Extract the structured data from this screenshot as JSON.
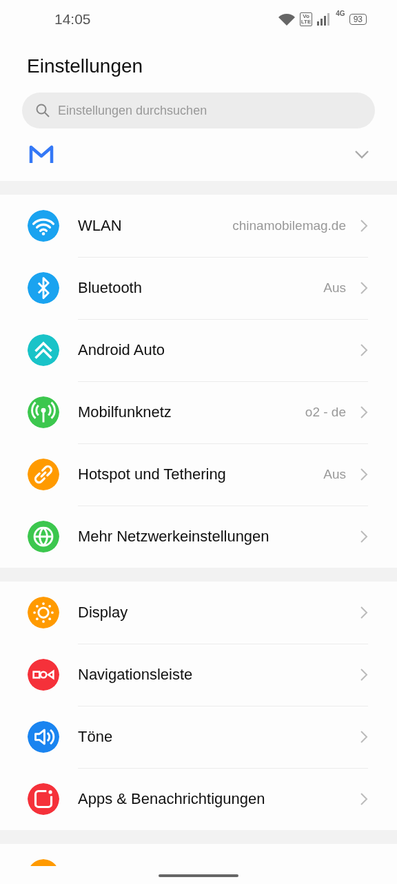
{
  "status_bar": {
    "time": "14:05",
    "volte_top": "Vo",
    "volte_bottom": "LTE",
    "network": "4G",
    "battery": "93"
  },
  "title": "Einstellungen",
  "search": {
    "placeholder": "Einstellungen durchsuchen"
  },
  "groups": [
    {
      "items": [
        {
          "kind": "wifi",
          "color": "#1aa3f0",
          "label": "WLAN",
          "value": "chinamobilemag.de"
        },
        {
          "kind": "bluetooth",
          "color": "#1aa3f0",
          "label": "Bluetooth",
          "value": "Aus"
        },
        {
          "kind": "auto",
          "color": "#19c3c8",
          "label": "Android Auto"
        },
        {
          "kind": "antenna",
          "color": "#3cc74e",
          "label": "Mobilfunknetz",
          "value": "o2 - de"
        },
        {
          "kind": "link",
          "color": "#ff9a00",
          "label": "Hotspot und Tethering",
          "value": "Aus"
        },
        {
          "kind": "globe",
          "color": "#3cc74e",
          "label": "Mehr Netzwerkeinstellungen"
        }
      ]
    },
    {
      "items": [
        {
          "kind": "sun",
          "color": "#ff9a00",
          "label": "Display"
        },
        {
          "kind": "nav",
          "color": "#f5313a",
          "label": "Navigationsleiste"
        },
        {
          "kind": "speaker",
          "color": "#1a84f0",
          "label": "Töne"
        },
        {
          "kind": "app",
          "color": "#f5313a",
          "label": "Apps & Benachrichtigungen"
        }
      ]
    },
    {
      "items": [
        {
          "kind": "partial",
          "color": "#ff9a00"
        }
      ]
    }
  ]
}
